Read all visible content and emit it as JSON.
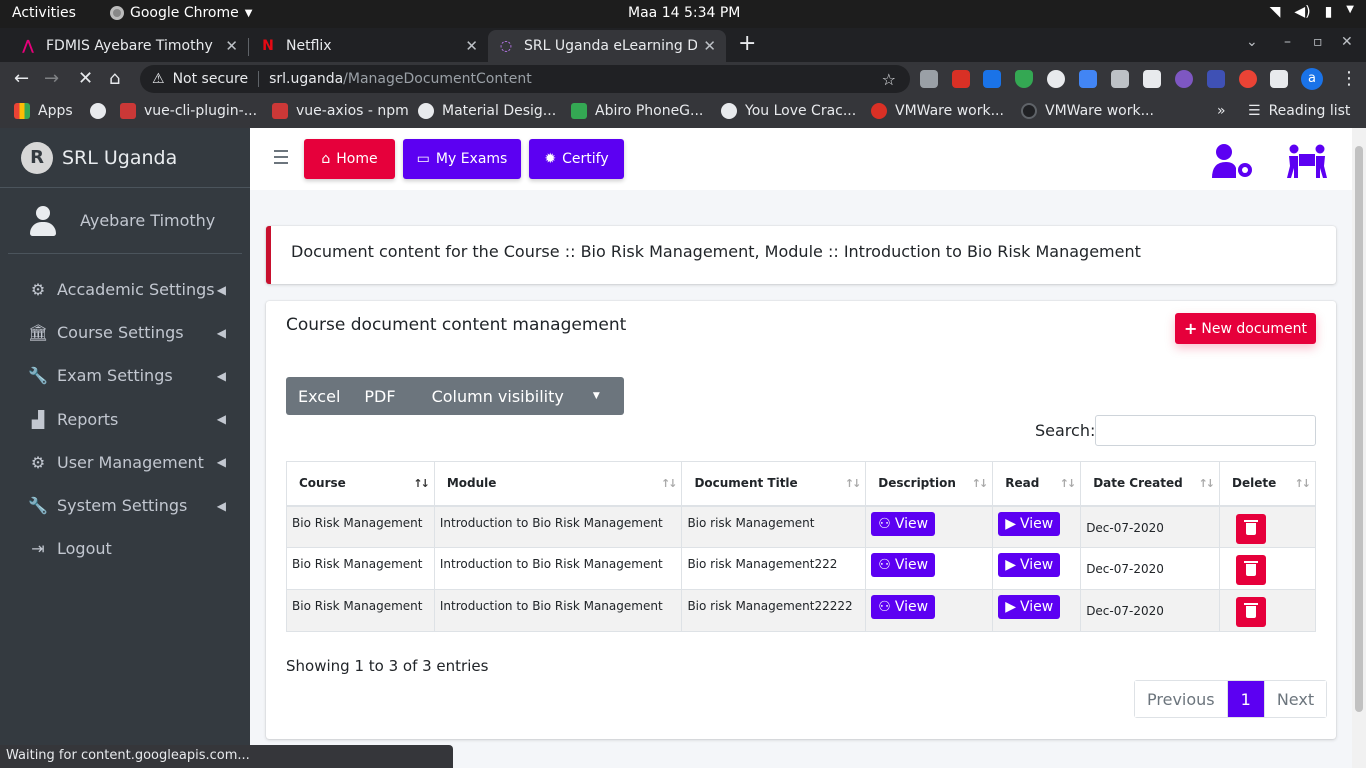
{
  "system": {
    "activities": "Activities",
    "app_name": "Google Chrome",
    "clock": "Maa 14   5:34 PM"
  },
  "tabs": [
    {
      "title": "FDMIS Ayebare Timothy",
      "favicon_color": "#e6007a"
    },
    {
      "title": "Netflix",
      "favicon_color": "#e50914"
    },
    {
      "title": "SRL Uganda eLearning Do",
      "favicon_color": "#9c27b0"
    }
  ],
  "address": {
    "security": "Not secure",
    "host": "srl.uganda",
    "path": "/ManageDocumentContent"
  },
  "bookmarks": [
    {
      "label": "Apps",
      "color": "#e0523f"
    },
    {
      "label": "vue-cli-plugin-...",
      "color": "#cb3837"
    },
    {
      "label": "vue-axios - npm",
      "color": "#cb3837"
    },
    {
      "label": "Material Desig...",
      "color": "#9aa0a6"
    },
    {
      "label": "Abiro PhoneG...",
      "color": "#34a853"
    },
    {
      "label": "You Love Crac...",
      "color": "#9aa0a6"
    },
    {
      "label": "VMWare work...",
      "color": "#d93025"
    },
    {
      "label": "VMWare work...",
      "color": "#5f6368"
    }
  ],
  "reading_list": "Reading list",
  "sidebar": {
    "brand": "SRL Uganda",
    "user": "Ayebare Timothy",
    "items": [
      {
        "label": "Accademic Settings",
        "icon": "gear-icon"
      },
      {
        "label": "Course Settings",
        "icon": "bank-icon"
      },
      {
        "label": "Exam Settings",
        "icon": "wrench-icon"
      },
      {
        "label": "Reports",
        "icon": "chart-icon"
      },
      {
        "label": "User Management",
        "icon": "gears-icon"
      },
      {
        "label": "System Settings",
        "icon": "wrench-icon"
      },
      {
        "label": "Logout",
        "icon": "sign-out-icon"
      }
    ]
  },
  "topnav": {
    "home": "Home",
    "my_exams": "My Exams",
    "certify": "Certify"
  },
  "colors": {
    "accent_purple": "#5c00f2",
    "accent_red": "#e6003b",
    "sidebar_bg": "#343a40"
  },
  "callout": "Document content for the Course :: Bio Risk Management, Module :: Introduction to Bio Risk Management",
  "card": {
    "title": "Course document content management",
    "new_button": "New document",
    "export_buttons": {
      "excel": "Excel",
      "pdf": "PDF",
      "colvis": "Column visibility"
    },
    "search_label": "Search:",
    "search_value": ""
  },
  "table": {
    "headers": [
      "Course",
      "Module",
      "Document Title",
      "Description",
      "Read",
      "Date Created",
      "Delete"
    ],
    "view_label": "View",
    "rows": [
      {
        "course": "Bio Risk Management",
        "module": "Introduction to Bio Risk Management",
        "title": "Bio risk Management",
        "date": "Dec-07-2020"
      },
      {
        "course": "Bio Risk Management",
        "module": "Introduction to Bio Risk Management",
        "title": "Bio risk Management222",
        "date": "Dec-07-2020"
      },
      {
        "course": "Bio Risk Management",
        "module": "Introduction to Bio Risk Management",
        "title": "Bio risk Management22222",
        "date": "Dec-07-2020"
      }
    ]
  },
  "info": "Showing 1 to 3 of 3 entries",
  "pager": {
    "previous": "Previous",
    "current": "1",
    "next": "Next"
  },
  "status": "Waiting for content.googleapis.com..."
}
